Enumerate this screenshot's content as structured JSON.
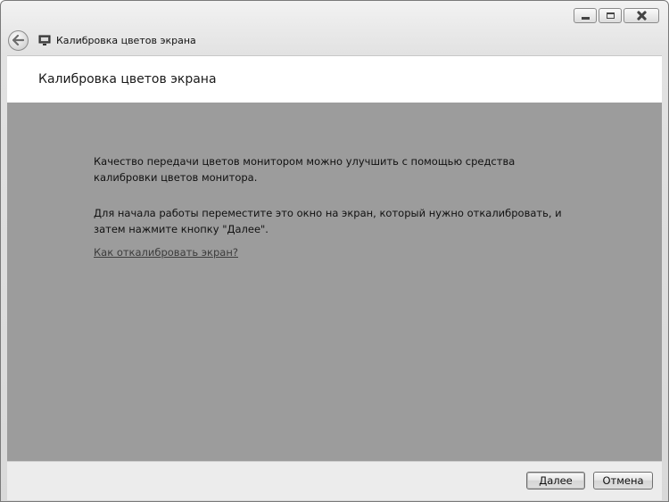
{
  "window": {
    "title": "Калибровка цветов экрана",
    "caption_icons": {
      "minimize": "minimize-icon",
      "maximize": "maximize-icon",
      "close": "close-icon"
    },
    "back_icon": "back-arrow-icon",
    "app_icon": "display-monitor-icon"
  },
  "header": {
    "title": "Калибровка цветов экрана"
  },
  "content": {
    "paragraph_1": "Качество передачи цветов монитором можно улучшить с помощью средства калибровки цветов монитора.",
    "paragraph_2": "Для начала работы переместите это окно на экран, который нужно откалибровать, и затем нажмите кнопку \"Далее\".",
    "help_link": "Как откалибровать экран?"
  },
  "footer": {
    "next_label": "Далее",
    "cancel_label": "Отмена"
  },
  "colors": {
    "content_background": "#9c9c9c",
    "header_background": "#ffffff",
    "footer_background": "#ececec"
  }
}
